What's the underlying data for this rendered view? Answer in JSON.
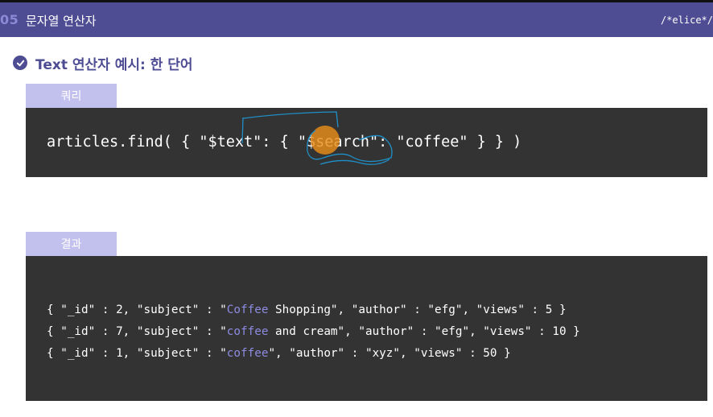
{
  "header": {
    "section_number": "05",
    "section_title": "문자열 연산자",
    "brand": "/*elice*/"
  },
  "heading": {
    "text": "Text 연산자 예시: 한 단어"
  },
  "query_section": {
    "tab_label": "쿼리",
    "code": "articles.find( { \"$text\": { \"$search\": \"coffee\" } } )"
  },
  "result_section": {
    "tab_label": "결과",
    "rows": [
      {
        "pre": "{ \"_id\" : 2, \"subject\" : \"",
        "hl": "Coffee",
        "post": " Shopping\", \"author\" : \"efg\", \"views\" : 5 }"
      },
      {
        "pre": "{ \"_id\" : 7, \"subject\" : \"",
        "hl": "coffee",
        "post": " and cream\", \"author\" : \"efg\", \"views\" : 10 }"
      },
      {
        "pre": "{ \"_id\" : 1, \"subject\" : \"",
        "hl": "coffee",
        "post": "\", \"author\" : \"xyz\", \"views\" : 50 }"
      }
    ]
  },
  "colors": {
    "header_bg": "#4e4d94",
    "tab_bg": "#c2c0ec",
    "code_bg": "#333333",
    "highlight": "#8d8be0",
    "cursor": "#e88c19",
    "annotation_ink": "#1f8fc7"
  }
}
